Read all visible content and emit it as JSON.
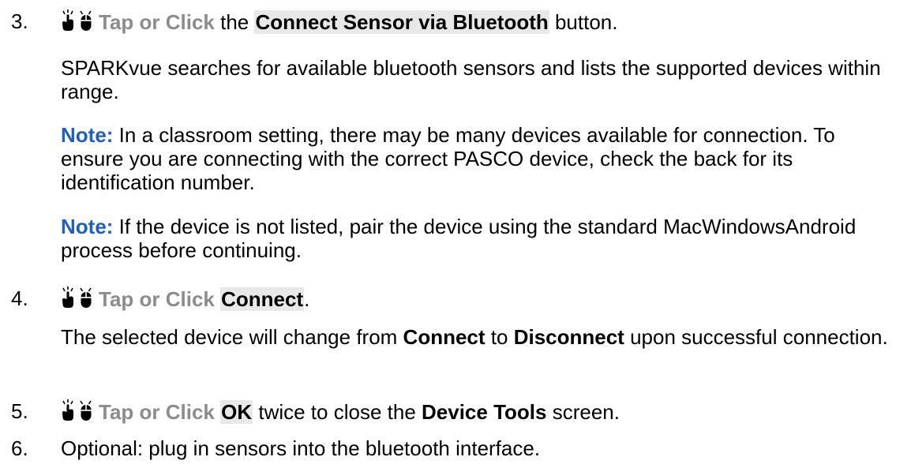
{
  "steps": [
    {
      "number": "3.",
      "tap_label": "Tap or Click",
      "text_before": " the ",
      "button": "Connect Sensor via Bluetooth",
      "text_after": " button.",
      "para1": "SPARKvue searches for available bluetooth sensors and lists the supported devices within range.",
      "note1_label": "Note:",
      "note1_text": " In a classroom setting, there may be many devices available for con­nection. To ensure you are connecting with the correct PASCO device, check the back for its identification number.",
      "note2_label": "Note:",
      "note2_text": " If the device is not listed, pair the device using the standard MacWindowsAndroid  process before continuing."
    },
    {
      "number": "4.",
      "tap_label": "Tap or Click",
      "button": "Connect",
      "text_after": ".",
      "para_before": "The selected device will change from ",
      "from_label": "Connect",
      "para_middle": " to ",
      "to_label": "Disconnect",
      "para_after": " upon successful connection."
    },
    {
      "number": "5.",
      "tap_label": "Tap or Click",
      "button": "OK",
      "text_middle": " twice to close the ",
      "screen_label": "Device Tools",
      "text_after": " screen."
    },
    {
      "number": "6.",
      "text": "Optional: plug in sensors into the bluetooth interface."
    }
  ],
  "icons": {
    "touch": "hand-tap-icon",
    "mouse": "mouse-click-icon"
  },
  "colors": {
    "note": "#1f5fbf",
    "tap_label": "#8c8c8c",
    "chip_bg": "#e8e8e8"
  }
}
